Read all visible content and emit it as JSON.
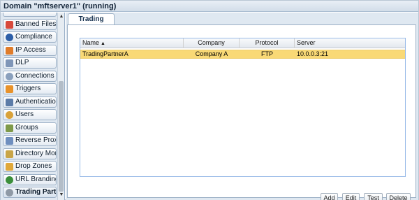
{
  "window": {
    "title": "Domain \"mftserver1\" (running)"
  },
  "sidebar": {
    "items": [
      {
        "label": "Banned Files",
        "icon": "banned-files-icon",
        "color": "#d84a3c"
      },
      {
        "label": "Compliance",
        "icon": "compliance-icon",
        "color": "#2d5fa8"
      },
      {
        "label": "IP Access",
        "icon": "ip-access-icon",
        "color": "#e07c2a"
      },
      {
        "label": "DLP",
        "icon": "dlp-icon",
        "color": "#7f96b8"
      },
      {
        "label": "Connections",
        "icon": "connections-icon",
        "color": "#8aa0bd"
      },
      {
        "label": "Triggers",
        "icon": "triggers-icon",
        "color": "#e8922a"
      },
      {
        "label": "Authentication",
        "icon": "authentication-icon",
        "color": "#5c7ca8"
      },
      {
        "label": "Users",
        "icon": "users-icon",
        "color": "#d9a23a"
      },
      {
        "label": "Groups",
        "icon": "groups-icon",
        "color": "#7f9a4a"
      },
      {
        "label": "Reverse Proxies",
        "icon": "reverse-proxies-icon",
        "color": "#6f8fbf"
      },
      {
        "label": "Directory Monitors",
        "icon": "directory-monitors-icon",
        "color": "#c9a547"
      },
      {
        "label": "Drop Zones",
        "icon": "drop-zones-icon",
        "color": "#e0a83a"
      },
      {
        "label": "URL Branding",
        "icon": "url-branding-icon",
        "color": "#3b8f3b"
      },
      {
        "label": "Trading Partners",
        "icon": "trading-partners-icon",
        "color": "#8f9aa6",
        "active": true
      }
    ]
  },
  "main": {
    "tab_label": "Trading Partners",
    "grid": {
      "columns": [
        "Name",
        "Company",
        "Protocol",
        "Server"
      ],
      "sort_indicator": "▲",
      "rows": [
        {
          "name": "TradingPartnerA",
          "company": "Company A",
          "protocol": "FTP",
          "server": "10.0.0.3:21",
          "selected": true
        }
      ]
    },
    "buttons": {
      "add": "Add",
      "edit": "Edit",
      "test": "Test",
      "delete": "Delete"
    }
  },
  "colors": {
    "selection": "#f9d976",
    "accent": "#15304f",
    "sidebar_bg": "#dfe8f1"
  }
}
